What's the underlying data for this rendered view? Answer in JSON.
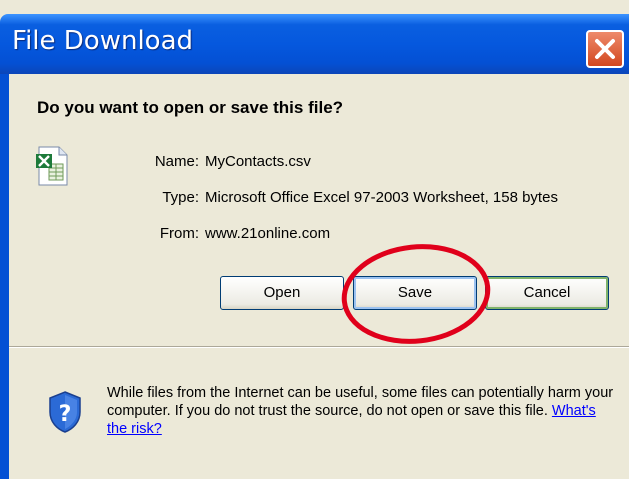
{
  "window": {
    "title": "File Download",
    "close_icon": "close-icon"
  },
  "dialog": {
    "question": "Do you want to open or save this file?",
    "file_icon": "excel-file-icon",
    "info": [
      {
        "label": "Name:",
        "value": "MyContacts.csv"
      },
      {
        "label": "Type:",
        "value": "Microsoft Office Excel 97-2003 Worksheet, 158 bytes"
      },
      {
        "label": "From:",
        "value": "www.21online.com"
      }
    ],
    "buttons": {
      "open": "Open",
      "save": "Save",
      "cancel": "Cancel"
    },
    "warning": {
      "text": "While files from the Internet can be useful, some files can potentially harm your computer. If you do not trust the source, do not open or save this file.",
      "link": "What's the risk?",
      "icon": "shield-question-icon"
    }
  },
  "annotation": {
    "shape": "red-ellipse",
    "target": "save-button",
    "color": "#e0001b"
  },
  "colors": {
    "titlebar": "#0558de",
    "dialog_bg": "#ece9d8",
    "close": "#d2471f"
  }
}
